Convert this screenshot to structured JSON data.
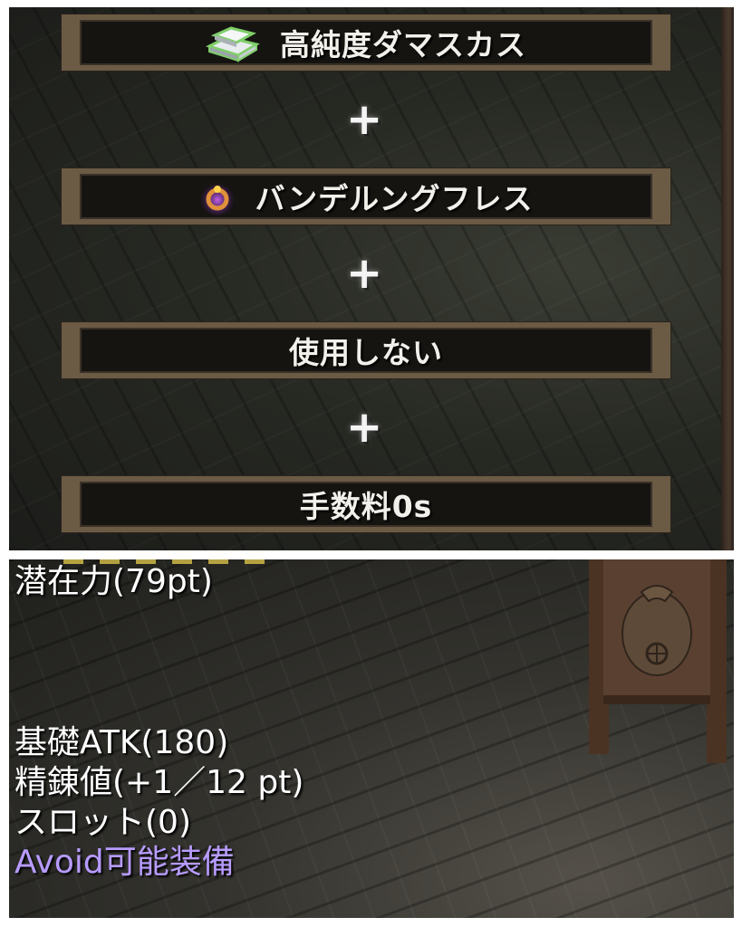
{
  "synthesis": {
    "slots": [
      {
        "label": "高純度ダマスカス",
        "icon": "ingot-icon"
      },
      {
        "label": "バンデルングフレス",
        "icon": "ring-icon"
      },
      {
        "label": "使用しない",
        "icon": ""
      },
      {
        "label": "手数料0s",
        "icon": ""
      }
    ],
    "plus_symbol": "+"
  },
  "item_stats": {
    "potential": "潜在力(79pt)",
    "base_atk": "基礎ATK(180)",
    "refine": "精錬値(+1／12 pt)",
    "slots": "スロット(0)",
    "avoid": "Avoid可能装備"
  },
  "colors": {
    "avoid_text": "#b79bff",
    "slot_border": "#6b5a44"
  }
}
